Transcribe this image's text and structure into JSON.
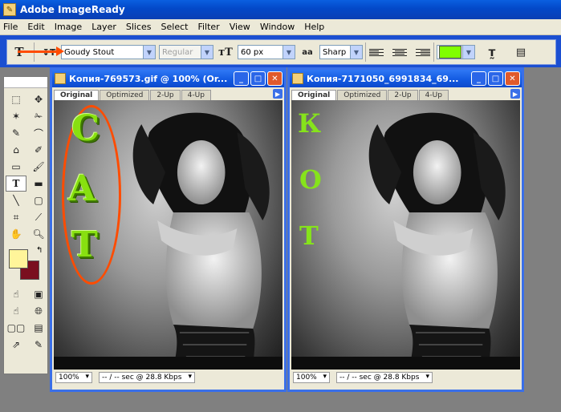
{
  "app": {
    "title": "Adobe ImageReady"
  },
  "menu": [
    "File",
    "Edit",
    "Image",
    "Layer",
    "Slices",
    "Select",
    "Filter",
    "View",
    "Window",
    "Help"
  ],
  "options": {
    "font_family": "Goudy Stout",
    "font_style": "Regular",
    "font_size": "60 px",
    "anti_alias": "Sharp",
    "text_color": "#80ff00"
  },
  "windows": [
    {
      "title": "Копия-769573.gif @ 100% (Or...",
      "tabs": [
        "Original",
        "Optimized",
        "2-Up",
        "4-Up"
      ],
      "active_tab": "Original",
      "letters": [
        "C",
        "A",
        "T"
      ],
      "zoom": "100%",
      "status": "-- / -- sec @ 28.8 Kbps"
    },
    {
      "title": "Копия-7171050_6991834_69...",
      "tabs": [
        "Original",
        "Optimized",
        "2-Up",
        "4-Up"
      ],
      "active_tab": "Original",
      "letters": [
        "К",
        "О",
        "Т"
      ],
      "zoom": "100%",
      "status": "-- / -- sec @ 28.8 Kbps"
    }
  ],
  "colors": {
    "foreground": "#fff59a",
    "background": "#7a0f1f",
    "accent": "#ff4c00",
    "titlebar": "#0a5fe0"
  }
}
